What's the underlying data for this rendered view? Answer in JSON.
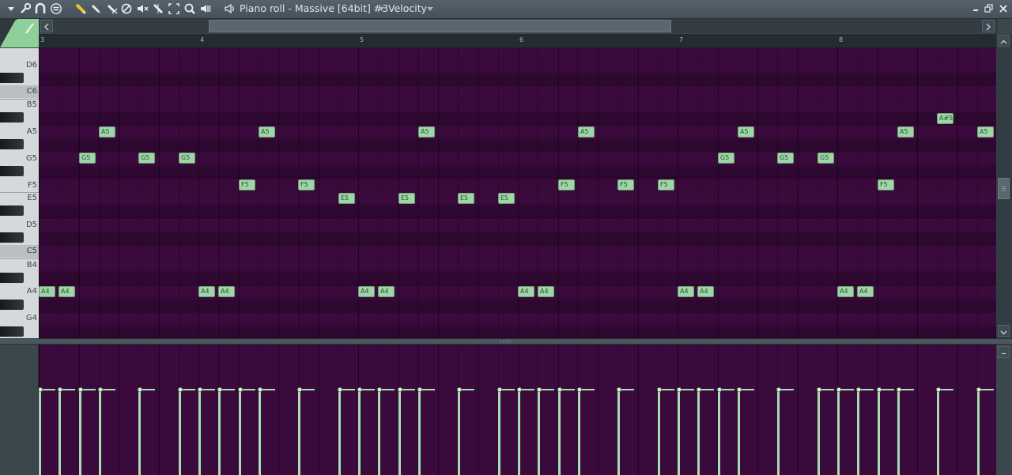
{
  "window": {
    "title": "Piano roll - Massive [64bit] #3",
    "mode": "Velocity"
  },
  "toolbar": {
    "icons": [
      "menu-arrow-icon",
      "wrench-icon",
      "magnet-icon",
      "stamp-icon",
      "pencil-icon",
      "paint-brush-icon",
      "delete-icon",
      "mute-icon",
      "slice-icon",
      "select-icon",
      "zoom-icon",
      "playback-icon",
      "speaker-icon"
    ]
  },
  "ruler": {
    "bars": [
      "3",
      "4",
      "5",
      "6",
      "7",
      "8"
    ]
  },
  "keyboard": {
    "labels": [
      "D6",
      "C6",
      "B5",
      "A5",
      "G5",
      "F5",
      "E5",
      "D5",
      "C5",
      "B4",
      "A4",
      "G4"
    ]
  },
  "notes": [
    {
      "label": "A4",
      "row": "A4",
      "start": 3.0
    },
    {
      "label": "A4",
      "row": "A4",
      "start": 3.125
    },
    {
      "label": "G5",
      "row": "G5",
      "start": 3.25
    },
    {
      "label": "A5",
      "row": "A5",
      "start": 3.375
    },
    {
      "label": "G5",
      "row": "G5",
      "start": 3.625
    },
    {
      "label": "G5",
      "row": "G5",
      "start": 3.875
    },
    {
      "label": "A4",
      "row": "A4",
      "start": 4.0
    },
    {
      "label": "A4",
      "row": "A4",
      "start": 4.125
    },
    {
      "label": "F5",
      "row": "F5",
      "start": 4.25
    },
    {
      "label": "A5",
      "row": "A5",
      "start": 4.375
    },
    {
      "label": "F5",
      "row": "F5",
      "start": 4.625
    },
    {
      "label": "E5",
      "row": "E5",
      "start": 4.875
    },
    {
      "label": "A4",
      "row": "A4",
      "start": 5.0
    },
    {
      "label": "A4",
      "row": "A4",
      "start": 5.125
    },
    {
      "label": "E5",
      "row": "E5",
      "start": 5.25
    },
    {
      "label": "A5",
      "row": "A5",
      "start": 5.375
    },
    {
      "label": "E5",
      "row": "E5",
      "start": 5.625
    },
    {
      "label": "E5",
      "row": "E5",
      "start": 5.875
    },
    {
      "label": "A4",
      "row": "A4",
      "start": 6.0
    },
    {
      "label": "A4",
      "row": "A4",
      "start": 6.125
    },
    {
      "label": "F5",
      "row": "F5",
      "start": 6.25
    },
    {
      "label": "A5",
      "row": "A5",
      "start": 6.375
    },
    {
      "label": "F5",
      "row": "F5",
      "start": 6.625
    },
    {
      "label": "F5",
      "row": "F5",
      "start": 6.875
    },
    {
      "label": "A4",
      "row": "A4",
      "start": 7.0
    },
    {
      "label": "A4",
      "row": "A4",
      "start": 7.125
    },
    {
      "label": "G5",
      "row": "G5",
      "start": 7.25
    },
    {
      "label": "A5",
      "row": "A5",
      "start": 7.375
    },
    {
      "label": "G5",
      "row": "G5",
      "start": 7.625
    },
    {
      "label": "G5",
      "row": "G5",
      "start": 7.875
    },
    {
      "label": "A4",
      "row": "A4",
      "start": 8.0
    },
    {
      "label": "A4",
      "row": "A4",
      "start": 8.125
    },
    {
      "label": "F5",
      "row": "F5",
      "start": 8.25
    },
    {
      "label": "A5",
      "row": "A5",
      "start": 8.375
    },
    {
      "label": "A#5",
      "row": "A#5",
      "start": 8.625
    },
    {
      "label": "A5",
      "row": "A5",
      "start": 8.875
    }
  ],
  "colors": {
    "grid_background": "#3a0a3c",
    "note_fill": "#9fd6a7",
    "velocity": "#a9dcb1"
  }
}
